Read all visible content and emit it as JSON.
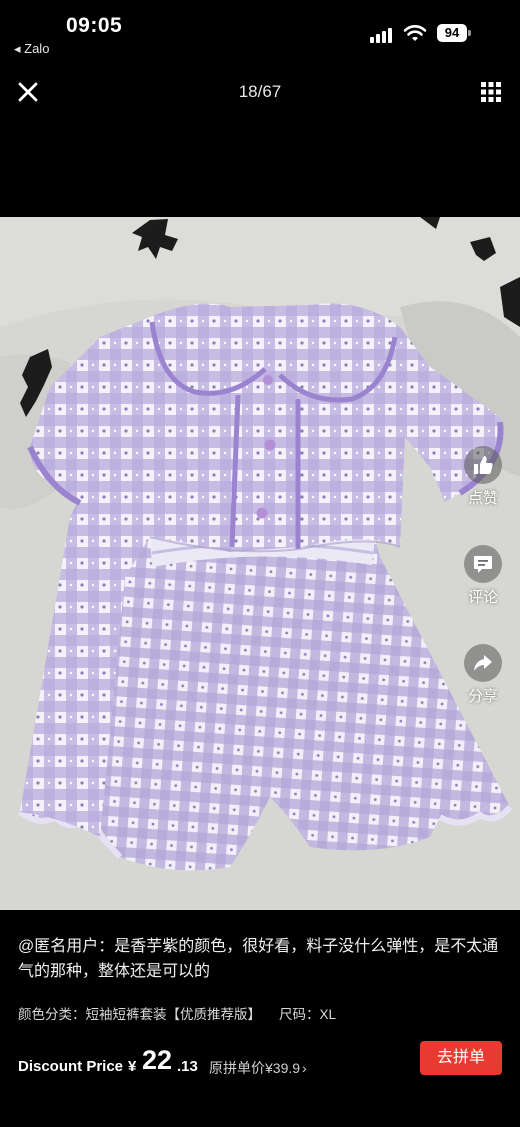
{
  "status_bar": {
    "time": "09:05",
    "back_app": "◂ Zalo",
    "battery": "94"
  },
  "viewer": {
    "counter": "18/67",
    "close_icon": "close-icon",
    "grid_icon": "grid-icon"
  },
  "photo": {
    "subject": "lavender gingham short-sleeve pajama set"
  },
  "actions": {
    "like_label": "点赞",
    "comment_label": "评论",
    "share_label": "分享"
  },
  "review": {
    "text": "@匿名用户：是香芋紫的颜色，很好看，料子没什么弹性，是不太通气的那种，整体还是可以的"
  },
  "spec": {
    "variant": "颜色分类：短袖短裤套装【优质推荐版】",
    "size": "尺码：XL"
  },
  "price": {
    "label": "Discount Price",
    "currency": "¥",
    "integer": "22",
    "decimal": ".13",
    "original": "原拼单价¥39.9",
    "button": "去拼单"
  },
  "colors": {
    "accent_red": "#e83a30",
    "background": "#000000"
  }
}
